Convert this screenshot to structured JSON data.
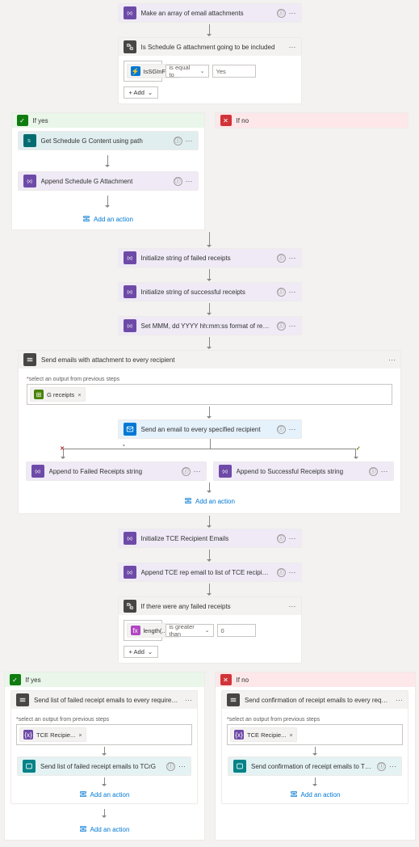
{
  "actions": {
    "make_array": "Make an array of email attachments",
    "cond_sg": {
      "title": "Is Schedule G attachment going to be included",
      "left_token": "IsSGInFor...",
      "op": "is equal to",
      "right": "Yes",
      "add": "+  Add"
    },
    "yes_label": "If yes",
    "no_label": "If no",
    "get_sg": "Get Schedule G Content using path",
    "append_sg": "Append Schedule G Attachment",
    "init_failed": "Initialize string of failed receipts",
    "init_success": "Initialize string of successful receipts",
    "set_fmt": "Set MMM, dd YYYY hh:mm:ss format of receipt email time",
    "foreach1": {
      "title": "Send emails with attachment to every recipient",
      "select_label": "*select an output from previous steps",
      "token": "G receipts",
      "send_email": "Send an email to every specified recipient",
      "app_fail": "Append to Failed Receipts string",
      "app_ok": "Append to Successful Receipts string"
    },
    "init_tce": "Initialize TCE Recipient Emails",
    "append_tce": "Append TCE rep email to list of TCE recipient emails",
    "cond_failed": {
      "title": "If there were any failed receipts",
      "token": "length(...)",
      "op": "is greater than",
      "right": "0",
      "add": "+  Add"
    },
    "yes2": {
      "foreach": "Send list of failed receipt emails to every required recipient in TCE",
      "select_label": "*select an output from previous steps",
      "token": "TCE Recipie...",
      "action": "Send list of failed receipt emails to TCrG"
    },
    "no2": {
      "foreach": "Send confirmation of receipt emails to every required recipient in TCE",
      "select_label": "*select an output from previous steps",
      "token": "TCE Recipie...",
      "action": "Send confirmation of receipt emails to TCrG"
    }
  },
  "ui": {
    "add_action": "Add an action",
    "more": "···",
    "info": "ⓘ",
    "close_x": "×",
    "chev": "⌄",
    "plus": "+"
  }
}
